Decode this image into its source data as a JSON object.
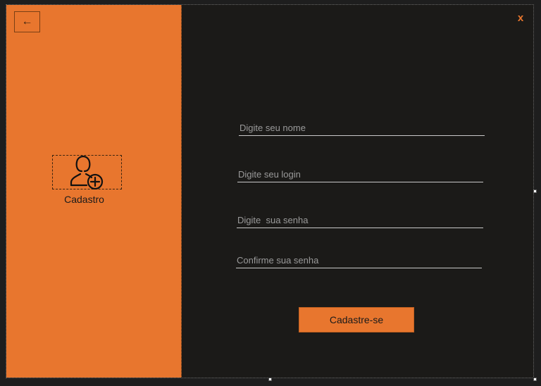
{
  "left_panel": {
    "back_icon": "arrow-left-icon",
    "back_glyph": "←",
    "user_add_icon": "user-add-icon",
    "label": "Cadastro",
    "color": "#e8762e"
  },
  "header": {
    "close_label": "x"
  },
  "form": {
    "name_placeholder": "Digite seu nome",
    "login_placeholder": "Digite seu login",
    "password_placeholder": "Digite  sua senha",
    "confirm_placeholder": "Confirme sua senha",
    "submit_label": "Cadastre-se"
  },
  "colors": {
    "accent": "#e8762e",
    "background": "#1b1a18"
  }
}
